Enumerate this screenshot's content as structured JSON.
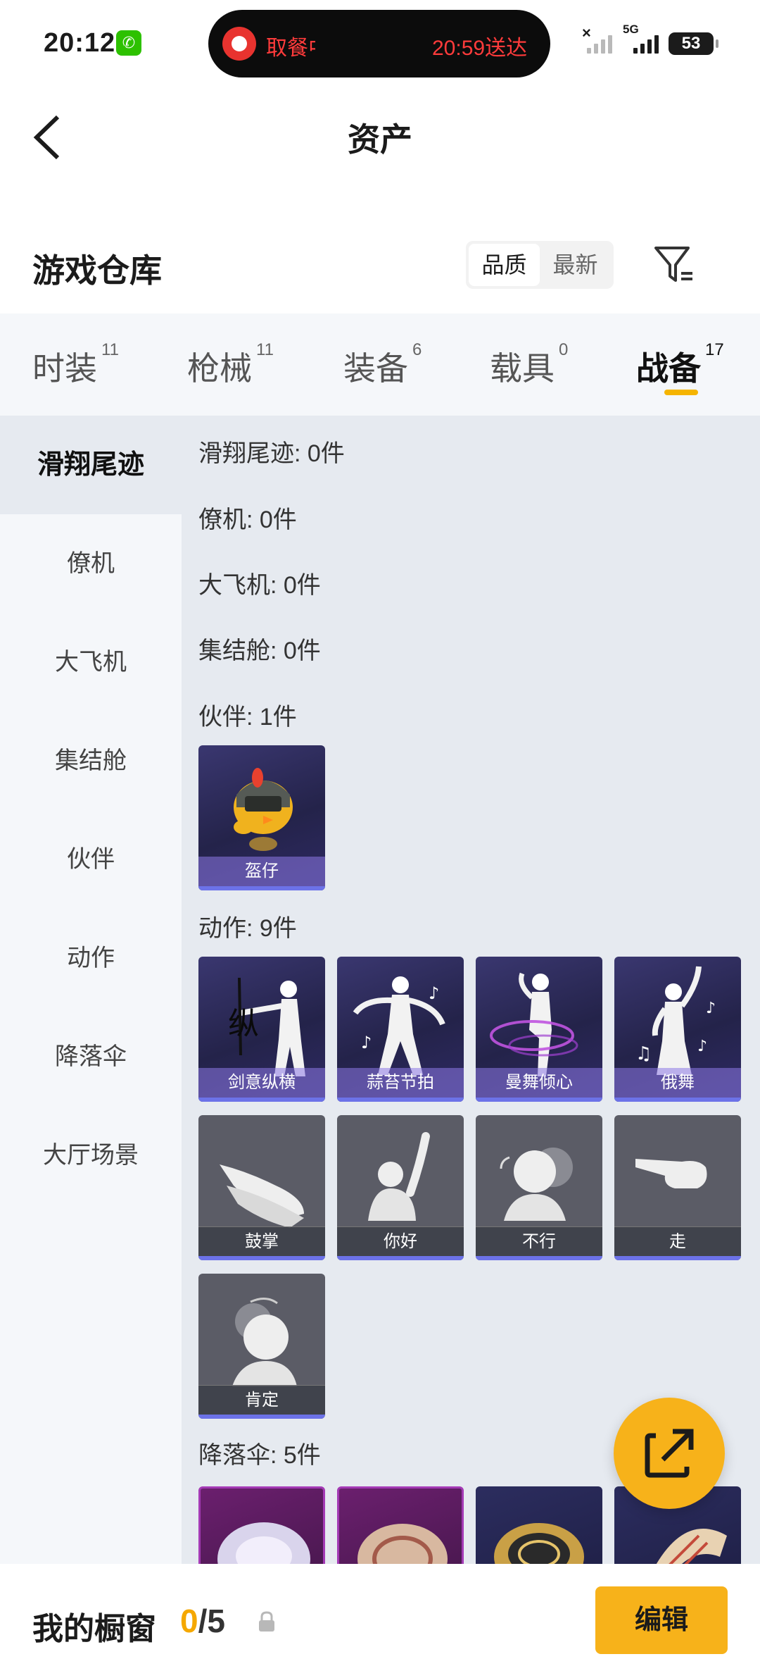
{
  "status_bar": {
    "time": "20:12",
    "island_left": "取餐中",
    "island_right": "20:59送达",
    "network": "5G",
    "battery": "53"
  },
  "nav": {
    "title": "资产"
  },
  "warehouse": {
    "title": "游戏仓库",
    "sort_options": [
      "品质",
      "最新"
    ],
    "active_sort": "品质"
  },
  "tabs": [
    {
      "label": "时装",
      "count": "11"
    },
    {
      "label": "枪械",
      "count": "11"
    },
    {
      "label": "装备",
      "count": "6"
    },
    {
      "label": "载具",
      "count": "0"
    },
    {
      "label": "战备",
      "count": "17"
    }
  ],
  "active_tab": "战备",
  "sidebar": {
    "items": [
      "滑翔尾迹",
      "僚机",
      "大飞机",
      "集结舱",
      "伙伴",
      "动作",
      "降落伞",
      "大厅场景"
    ],
    "active": "滑翔尾迹"
  },
  "sections": {
    "glide_trail": "滑翔尾迹: 0件",
    "wingman": "僚机: 0件",
    "big_plane": "大飞机: 0件",
    "assembly_pod": "集结舱: 0件",
    "partner": "伙伴: 1件",
    "emote": "动作: 9件",
    "parachute": "降落伞: 5件"
  },
  "partner_items": [
    "盔仔"
  ],
  "emote_items": [
    "剑意纵横",
    "蒜苔节拍",
    "曼舞倾心",
    "俄舞",
    "鼓掌",
    "你好",
    "不行",
    "走",
    "肯定"
  ],
  "bottom": {
    "label": "我的橱窗",
    "current": "0",
    "separator": "/5",
    "edit_label": "编辑"
  },
  "colors": {
    "accent": "#f7b21a",
    "content_bg": "#e6eaf0",
    "sidebar_bg": "#f5f7fa",
    "card_purple": "#2e2a63",
    "card_gray": "#5b5c66"
  }
}
